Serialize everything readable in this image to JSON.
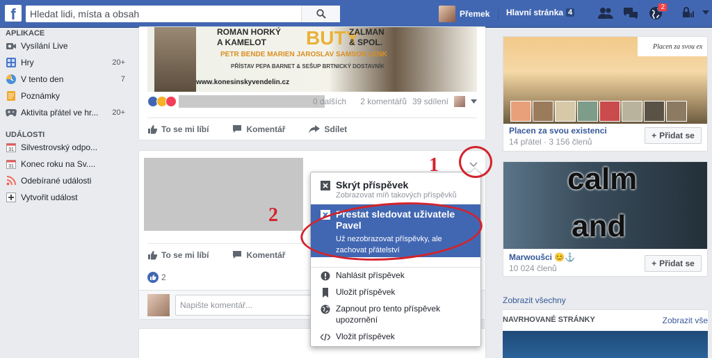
{
  "colors": {
    "brand": "#4267b2",
    "annotation": "#d3232d",
    "highlight": "#4267b2"
  },
  "topbar": {
    "search_placeholder": "Hledat lidi, místa a obsah",
    "user_name": "Přemek",
    "home_label": "Hlavní stránka",
    "home_count": "4",
    "notifications_count": "2"
  },
  "sidebar": {
    "apps_title": "APLIKACE",
    "apps": [
      {
        "label": "Vysílání Live",
        "count": "",
        "icon": "video-icon"
      },
      {
        "label": "Hry",
        "count": "20+",
        "icon": "games-icon"
      },
      {
        "label": "V tento den",
        "count": "7",
        "icon": "clock-icon"
      },
      {
        "label": "Poznámky",
        "count": "",
        "icon": "notes-icon"
      },
      {
        "label": "Aktivita přátel ve hr...",
        "count": "20+",
        "icon": "gamepad-icon"
      }
    ],
    "events_title": "UDÁLOSTI",
    "events": [
      {
        "label": "Silvestrovský odpo...",
        "icon": "calendar-icon"
      },
      {
        "label": "Konec roku na Sv....",
        "icon": "calendar-icon"
      },
      {
        "label": "Odebírané události",
        "icon": "rss-icon"
      },
      {
        "label": "Vytvořit událost",
        "icon": "plus-icon"
      }
    ]
  },
  "post1": {
    "poster_line1": "ROMAN HORKÝ\nA KAMELOT",
    "poster_big": "BUTY",
    "poster_line2": "ZALMAN\n& SPOL.",
    "poster_names": "PETR BENDE   MARIEN   JAROSLAV SAMSON LENK",
    "poster_places": "PŘÍSTAV   PEPA BARNET & SEŠUP   BRTNICKÝ DOSTAVNÍK",
    "poster_url": "www.konesinskyvendelin.cz",
    "others": "0 dalších",
    "comments": "2 komentářů",
    "shares": "39 sdílení",
    "like": "To se mi líbí",
    "comment": "Komentář",
    "share": "Sdílet"
  },
  "post2": {
    "like": "To se mi líbí",
    "comment": "Komentář",
    "likes_count": "2",
    "comment_placeholder": "Napište komentář..."
  },
  "dropdown": {
    "hide_title": "Skrýt příspěvek",
    "hide_sub": "Zobrazovat míň takových příspěvků",
    "unfollow_title": "Přestat sledovat uživatele Pavel",
    "unfollow_sub": "Už nezobrazovat příspěvky, ale zachovat přátelství",
    "report": "Nahlásit příspěvek",
    "save": "Uložit příspěvek",
    "notify": "Zapnout pro tento příspěvek upozornění",
    "embed": "Vložit příspěvek"
  },
  "annotations": {
    "step1": "1",
    "step2": "2"
  },
  "groups": [
    {
      "banner": "Placen za svou ex",
      "name": "Placen za svou existenci",
      "meta": "14 přátel · 3 156 členů",
      "join": "Přidat se"
    },
    {
      "word1": "calm",
      "word2": "and",
      "name": "Marwoušci 😊⚓",
      "meta": "10 024 členů",
      "join": "Přidat se"
    }
  ],
  "right": {
    "show_all": "Zobrazit všechny",
    "suggested_title": "NAVRHOVANÉ STRÁNKY",
    "suggested_all": "Zobrazit vše"
  }
}
